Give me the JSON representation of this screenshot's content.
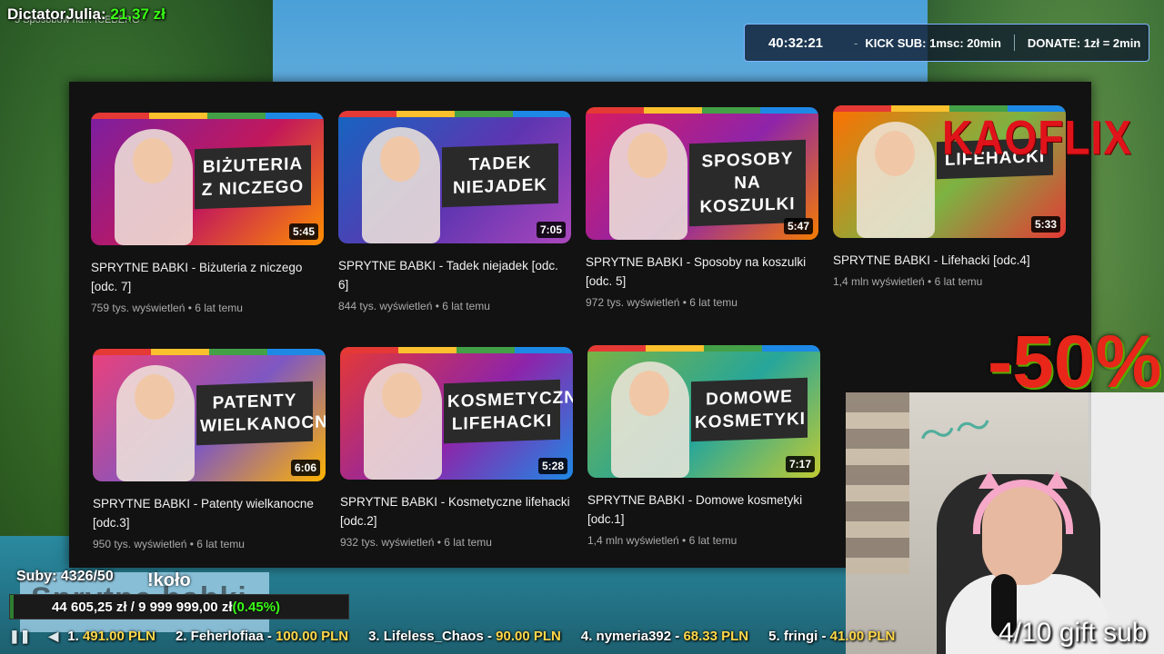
{
  "stream": {
    "top_donor": {
      "name": "DictatorJulia:",
      "amount": "21,37 zł"
    },
    "top_donor_sub": "5 Sposobów na... ICEBERG",
    "timer": {
      "time": "40:32:21",
      "kick_sub": "KICK SUB: 1msc: 20min",
      "donate": "DONATE: 1zł = 2min"
    },
    "kaoflix_logo": "KAOFLIX",
    "discount": "-50%",
    "gift_sub": "4/10 gift sub",
    "subs": {
      "label": "Suby: 4326/50",
      "overlay_text": "Sprytne babki",
      "overlay_word": "!koło"
    },
    "goal": {
      "text": "44 605,25 zł / 9 999 999,00 zł",
      "percent": "(0.45%)",
      "fill_fraction": 0.0045
    },
    "ticker": [
      {
        "text": "1. ",
        "amount": "491.00 PLN"
      },
      {
        "text": "2. Feherlofiaa - ",
        "amount": "100.00 PLN"
      },
      {
        "text": "3. Lifeless_Chaos - ",
        "amount": "90.00 PLN"
      },
      {
        "text": "4. nymeria392 - ",
        "amount": "68.33 PLN"
      },
      {
        "text": "5. fringi - ",
        "amount": "41.00 PLN"
      }
    ]
  },
  "videos": [
    {
      "thumb_text": "BIŻUTERIA Z NICZEGO",
      "duration": "5:45",
      "title": "SPRYTNE BABKI - Biżuteria z niczego [odc. 7]",
      "meta": "759 tys. wyświetleń • 6 lat temu",
      "colors": [
        "#7b1fa2",
        "#c2185b",
        "#ff8f00"
      ]
    },
    {
      "thumb_text": "TADEK NIEJADEK",
      "duration": "7:05",
      "title": "SPRYTNE BABKI - Tadek niejadek [odc. 6]",
      "meta": "844 tys. wyświetleń • 6 lat temu",
      "colors": [
        "#1565c0",
        "#5e35b1",
        "#ab47bc"
      ]
    },
    {
      "thumb_text": "SPOSOBY NA KOSZULKI",
      "duration": "5:47",
      "title": "SPRYTNE BABKI - Sposoby na koszulki [odc. 5]",
      "meta": "972 tys. wyświetleń • 6 lat temu",
      "colors": [
        "#d81b60",
        "#8e24aa",
        "#f57c00"
      ]
    },
    {
      "thumb_text": "LIFEHACKI",
      "duration": "5:33",
      "title": "SPRYTNE BABKI - Lifehacki [odc.4]",
      "meta": "1,4 mln wyświetleń • 6 lat temu",
      "colors": [
        "#ff6f00",
        "#7cb342",
        "#e53935"
      ]
    },
    {
      "thumb_text": "PATENTY WIELKANOCNE",
      "duration": "6:06",
      "title": "SPRYTNE BABKI - Patenty wielkanocne [odc.3]",
      "meta": "950 tys. wyświetleń • 6 lat temu",
      "colors": [
        "#ec407a",
        "#7e57c2",
        "#ffb300"
      ]
    },
    {
      "thumb_text": "KOSMETYCZNE LIFEHACKI",
      "duration": "5:28",
      "title": "SPRYTNE BABKI - Kosmetyczne lifehacki [odc.2]",
      "meta": "932 tys. wyświetleń • 6 lat temu",
      "colors": [
        "#e53935",
        "#8e24aa",
        "#1e88e5"
      ]
    },
    {
      "thumb_text": "DOMOWE KOSMETYKI",
      "duration": "7:17",
      "title": "SPRYTNE BABKI - Domowe kosmetyki [odc.1]",
      "meta": "1,4 mln wyświetleń • 6 lat temu",
      "colors": [
        "#7cb342",
        "#26a69a",
        "#c0ca33"
      ]
    }
  ]
}
